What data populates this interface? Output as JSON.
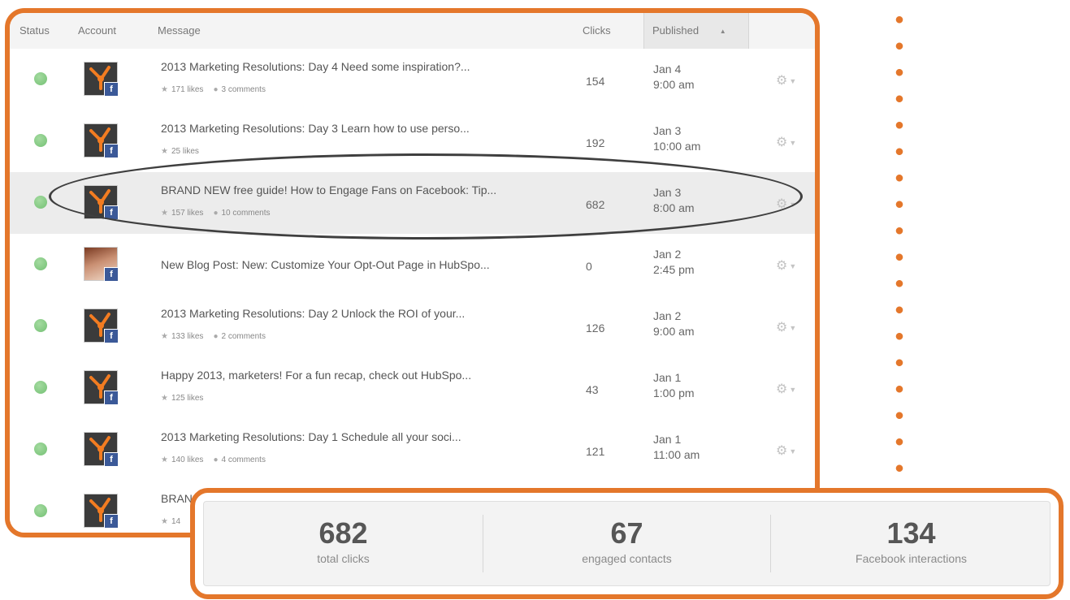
{
  "table": {
    "headers": {
      "status": "Status",
      "account": "Account",
      "message": "Message",
      "clicks": "Clicks",
      "published": "Published"
    },
    "rows": [
      {
        "message": "2013 Marketing Resolutions: Day 4 Need some inspiration?...",
        "likes": "171 likes",
        "comments": "3 comments",
        "clicks": "154",
        "date": "Jan 4",
        "time": "9:00 am",
        "avatar": "hubspot-logo"
      },
      {
        "message": "2013 Marketing Resolutions: Day 3 Learn how to use perso...",
        "likes": "25 likes",
        "comments": "",
        "clicks": "192",
        "date": "Jan 3",
        "time": "10:00 am",
        "avatar": "hubspot-logo"
      },
      {
        "message": "BRAND NEW free guide! How to Engage Fans on Facebook: Tip...",
        "likes": "157 likes",
        "comments": "10 comments",
        "clicks": "682",
        "date": "Jan 3",
        "time": "8:00 am",
        "avatar": "hubspot-logo",
        "highlighted": true
      },
      {
        "message": "New Blog Post: New: Customize Your Opt-Out Page in HubSpo...",
        "likes": "",
        "comments": "",
        "clicks": "0",
        "date": "Jan 2",
        "time": "2:45 pm",
        "avatar": "person-photo"
      },
      {
        "message": "2013 Marketing Resolutions: Day 2 Unlock the ROI of your...",
        "likes": "133 likes",
        "comments": "2 comments",
        "clicks": "126",
        "date": "Jan 2",
        "time": "9:00 am",
        "avatar": "hubspot-logo"
      },
      {
        "message": "Happy 2013, marketers! For a fun recap, check out HubSpo...",
        "likes": "125 likes",
        "comments": "",
        "clicks": "43",
        "date": "Jan 1",
        "time": "1:00 pm",
        "avatar": "hubspot-logo"
      },
      {
        "message": "2013 Marketing Resolutions: Day 1 Schedule all your soci...",
        "likes": "140 likes",
        "comments": "4 comments",
        "clicks": "121",
        "date": "Jan 1",
        "time": "11:00 am",
        "avatar": "hubspot-logo"
      },
      {
        "message": "BRAN",
        "likes": "14",
        "comments": "",
        "clicks": "",
        "date": "",
        "time": "",
        "avatar": "hubspot-logo"
      }
    ]
  },
  "stats": [
    {
      "value": "682",
      "label": "total clicks"
    },
    {
      "value": "67",
      "label": "engaged contacts"
    },
    {
      "value": "134",
      "label": "Facebook interactions"
    }
  ],
  "colors": {
    "frame": "#e4772b",
    "status_ok": "#7cc47a",
    "facebook": "#3b5998"
  },
  "icons": {
    "like": "star-icon",
    "comment": "comment-icon",
    "actions": "gear-icon",
    "sort": "sort-ascending-icon"
  }
}
